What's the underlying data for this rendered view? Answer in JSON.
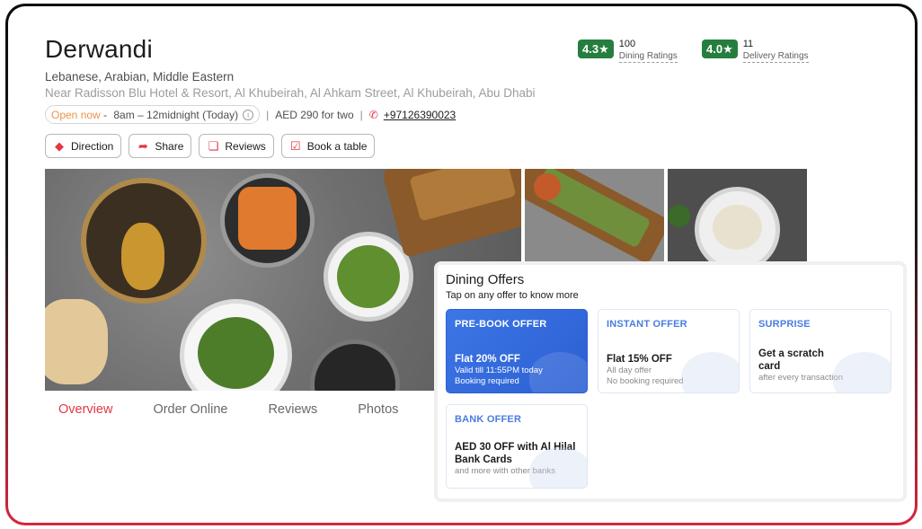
{
  "restaurant": {
    "name": "Derwandi",
    "cuisines": "Lebanese, Arabian, Middle Eastern",
    "address": "Near Radisson Blu Hotel & Resort, Al Khubeirah, Al Ahkam Street, Al Khubeirah, Abu Dhabi",
    "open_status": "Open now",
    "hours_separator": " - ",
    "hours": "8am – 12midnight (Today)",
    "cost": "AED 290 for two",
    "phone": "+97126390023"
  },
  "ratings": [
    {
      "value": "4.3",
      "count": "100",
      "label": "Dining Ratings"
    },
    {
      "value": "4.0",
      "count": "11",
      "label": "Delivery Ratings"
    }
  ],
  "actions": [
    {
      "label": "Direction",
      "icon": "direction-icon"
    },
    {
      "label": "Share",
      "icon": "share-icon"
    },
    {
      "label": "Reviews",
      "icon": "reviews-icon"
    },
    {
      "label": "Book a table",
      "icon": "calendar-icon"
    }
  ],
  "tabs": [
    {
      "label": "Overview",
      "active": true
    },
    {
      "label": "Order Online",
      "active": false
    },
    {
      "label": "Reviews",
      "active": false
    },
    {
      "label": "Photos",
      "active": false
    }
  ],
  "offers": {
    "title": "Dining Offers",
    "subtitle": "Tap on any offer to know more",
    "cards": [
      {
        "kind": "PRE-BOOK OFFER",
        "headline": "Flat 20% OFF",
        "detail1": "Valid till 11:55PM today",
        "detail2": "Booking required"
      },
      {
        "kind": "INSTANT OFFER",
        "headline": "Flat 15% OFF",
        "detail1": "All day offer",
        "detail2": "No booking required"
      },
      {
        "kind": "SURPRISE",
        "headline": "Get a scratch card",
        "detail1": "after every transaction",
        "detail2": ""
      },
      {
        "kind": "BANK OFFER",
        "headline": "AED 30 OFF with Al Hilal Bank Cards",
        "detail1": "and more with other banks",
        "detail2": ""
      }
    ]
  },
  "colors": {
    "accent": "#e23744",
    "rating_green": "#267e3e",
    "offer_blue": "#3d76e6",
    "open_orange": "#e8964a"
  }
}
